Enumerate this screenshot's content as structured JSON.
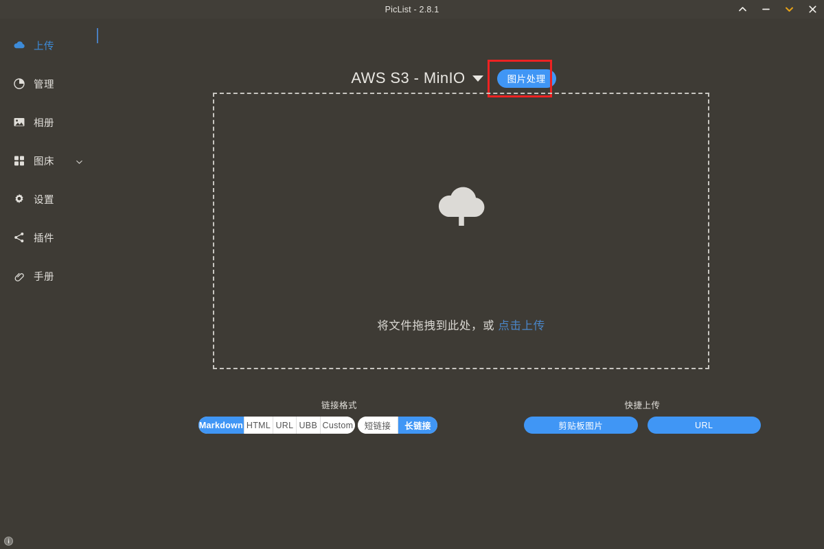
{
  "window": {
    "title": "PicList - 2.8.1",
    "controls": [
      {
        "name": "collapse-up-button",
        "icon": "chevron-up-icon",
        "color": "#f0eeea"
      },
      {
        "name": "minimize-button",
        "icon": "minus-icon",
        "color": "#f0eeea"
      },
      {
        "name": "expand-down-button",
        "icon": "chevron-down-icon",
        "color": "#e8a317"
      },
      {
        "name": "close-button",
        "icon": "close-icon",
        "color": "#f0eeea"
      }
    ]
  },
  "sidebar": {
    "items": [
      {
        "label": "上传",
        "icon": "cloud-upload-icon",
        "active": true,
        "chevron": false
      },
      {
        "label": "管理",
        "icon": "pie-chart-icon",
        "active": false,
        "chevron": false
      },
      {
        "label": "相册",
        "icon": "image-icon",
        "active": false,
        "chevron": false
      },
      {
        "label": "图床",
        "icon": "grid-icon",
        "active": false,
        "chevron": true
      },
      {
        "label": "设置",
        "icon": "gear-icon",
        "active": false,
        "chevron": false
      },
      {
        "label": "插件",
        "icon": "share-icon",
        "active": false,
        "chevron": false
      },
      {
        "label": "手册",
        "icon": "link-icon",
        "active": false,
        "chevron": false
      }
    ]
  },
  "header": {
    "bed_name": "AWS S3 - MinIO",
    "image_process_label": "图片处理",
    "annotation_color": "#ee2222"
  },
  "dropzone": {
    "icon": "cloud-upload-large-icon",
    "prompt": "将文件拖拽到此处，或",
    "link": "点击上传"
  },
  "link_format": {
    "label": "链接格式",
    "formats": [
      {
        "label": "Markdown",
        "active": true
      },
      {
        "label": "HTML",
        "active": false
      },
      {
        "label": "URL",
        "active": false
      },
      {
        "label": "UBB",
        "active": false
      },
      {
        "label": "Custom",
        "active": false
      }
    ],
    "lengths": [
      {
        "label": "短链接",
        "active": false
      },
      {
        "label": "长链接",
        "active": true
      }
    ]
  },
  "quick_upload": {
    "label": "快捷上传",
    "buttons": [
      {
        "label": "剪贴板图片"
      },
      {
        "label": "URL"
      }
    ]
  },
  "footer": {
    "info_icon": "info-circle-icon"
  },
  "theme": {
    "background": "#3e3b35",
    "titlebar": "#413e38",
    "accent_blue": "#4096f5",
    "link_blue": "#4a86c8",
    "text": "#e6e4df"
  }
}
